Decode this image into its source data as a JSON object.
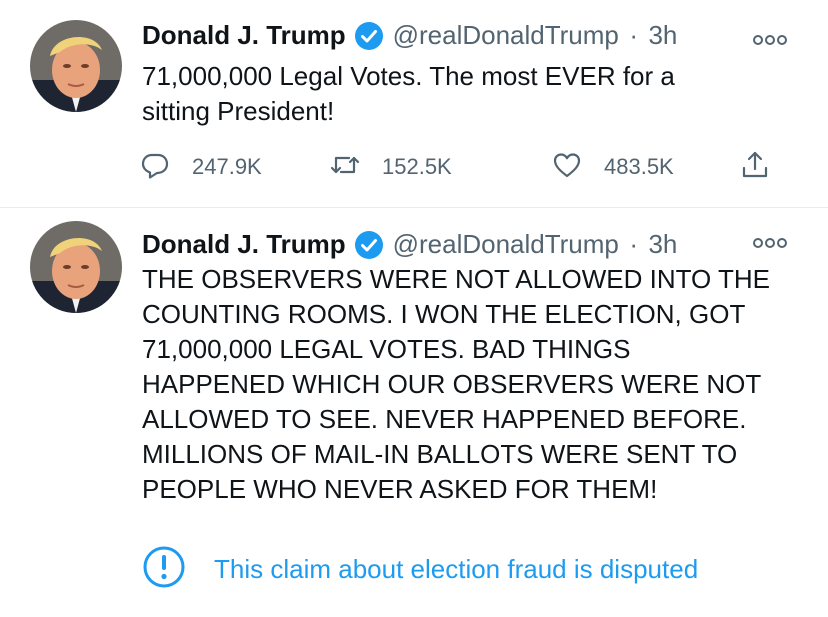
{
  "tweets": [
    {
      "author": {
        "name": "Donald J. Trump",
        "handle": "@realDonaldTrump",
        "verified": true
      },
      "separator": "·",
      "time": "3h",
      "text_lines": [
        "71,000,000 Legal Votes. The most EVER for a",
        "sitting President!"
      ],
      "actions": {
        "replies": "247.9K",
        "retweets": "152.5K",
        "likes": "483.5K"
      }
    },
    {
      "author": {
        "name": "Donald J. Trump",
        "handle": "@realDonaldTrump",
        "verified": true
      },
      "separator": "·",
      "time": "3h",
      "text_lines": [
        "THE OBSERVERS WERE NOT ALLOWED INTO THE",
        "COUNTING ROOMS. I WON THE ELECTION, GOT",
        "71,000,000 LEGAL VOTES. BAD THINGS",
        "HAPPENED WHICH OUR OBSERVERS WERE NOT",
        "ALLOWED TO SEE. NEVER HAPPENED BEFORE.",
        "MILLIONS OF MAIL-IN BALLOTS WERE SENT TO",
        "PEOPLE WHO NEVER ASKED FOR THEM!"
      ],
      "notice": {
        "icon": "exclamation-circle-icon",
        "text": "This claim about election fraud is disputed"
      }
    }
  ],
  "colors": {
    "accent": "#1d9bf0",
    "secondary_text": "#536471",
    "primary_text": "#0f1419",
    "divider": "#e6ecf0"
  }
}
